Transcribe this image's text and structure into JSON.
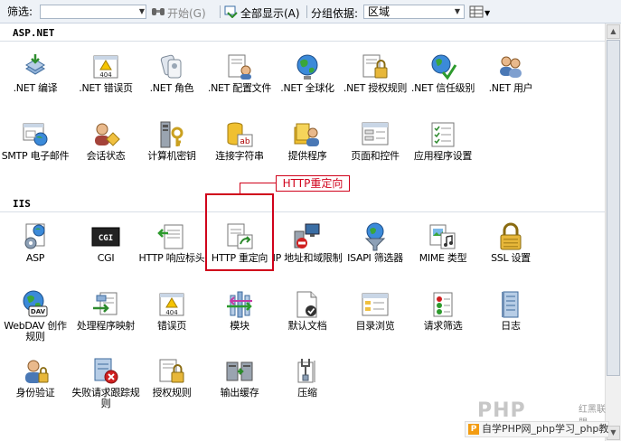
{
  "toolbar": {
    "filter_label": "筛选:",
    "start_label": "开始(G)",
    "show_all_label": "全部显示(A)",
    "group_by_label": "分组依据:",
    "group_value": "区域"
  },
  "sections": [
    {
      "title": "ASP.NET",
      "items": [
        {
          "label": ".NET 编译",
          "icon": "compile-icon"
        },
        {
          "label": ".NET 错误页",
          "icon": "error-page-icon"
        },
        {
          "label": ".NET 角色",
          "icon": "roles-icon"
        },
        {
          "label": ".NET 配置文件",
          "icon": "profile-icon"
        },
        {
          "label": ".NET 全球化",
          "icon": "globe-icon"
        },
        {
          "label": ".NET 授权规则",
          "icon": "authorization-icon"
        },
        {
          "label": ".NET 信任级别",
          "icon": "trust-icon"
        },
        {
          "label": ".NET 用户",
          "icon": "users-icon"
        },
        {
          "label": "SMTP 电子邮件",
          "icon": "smtp-icon"
        },
        {
          "label": "会话状态",
          "icon": "session-icon"
        },
        {
          "label": "计算机密钥",
          "icon": "machine-key-icon"
        },
        {
          "label": "连接字符串",
          "icon": "connection-string-icon"
        },
        {
          "label": "提供程序",
          "icon": "providers-icon"
        },
        {
          "label": "页面和控件",
          "icon": "pages-controls-icon"
        },
        {
          "label": "应用程序设置",
          "icon": "app-settings-icon"
        }
      ]
    },
    {
      "title": "IIS",
      "items": [
        {
          "label": "ASP",
          "icon": "asp-icon"
        },
        {
          "label": "CGI",
          "icon": "cgi-icon"
        },
        {
          "label": "HTTP 响应标头",
          "icon": "http-headers-icon"
        },
        {
          "label": "HTTP 重定向",
          "icon": "http-redirect-icon"
        },
        {
          "label": "IP 地址和域限制",
          "icon": "ip-restrict-icon"
        },
        {
          "label": "ISAPI 筛选器",
          "icon": "isapi-icon"
        },
        {
          "label": "MIME 类型",
          "icon": "mime-icon"
        },
        {
          "label": "SSL 设置",
          "icon": "ssl-lock-icon"
        },
        {
          "label": "WebDAV 创作规则",
          "icon": "webdav-icon"
        },
        {
          "label": "处理程序映射",
          "icon": "handler-icon"
        },
        {
          "label": "错误页",
          "icon": "error-page-icon"
        },
        {
          "label": "模块",
          "icon": "modules-icon"
        },
        {
          "label": "默认文档",
          "icon": "default-doc-icon"
        },
        {
          "label": "目录浏览",
          "icon": "dir-browse-icon"
        },
        {
          "label": "请求筛选",
          "icon": "request-filter-icon"
        },
        {
          "label": "日志",
          "icon": "logging-icon"
        },
        {
          "label": "身份验证",
          "icon": "auth-icon"
        },
        {
          "label": "失败请求跟踪规则",
          "icon": "failed-trace-icon"
        },
        {
          "label": "授权规则",
          "icon": "authorization-icon"
        },
        {
          "label": "输出缓存",
          "icon": "output-cache-icon"
        },
        {
          "label": "压缩",
          "icon": "compression-icon"
        }
      ]
    }
  ],
  "callout": {
    "text": "HTTP重定向",
    "color": "#d0021b"
  },
  "watermark": {
    "logo": "PHP",
    "sub": "红黑联盟"
  },
  "footer": {
    "text": "自学PHP网_php学习_php教"
  }
}
